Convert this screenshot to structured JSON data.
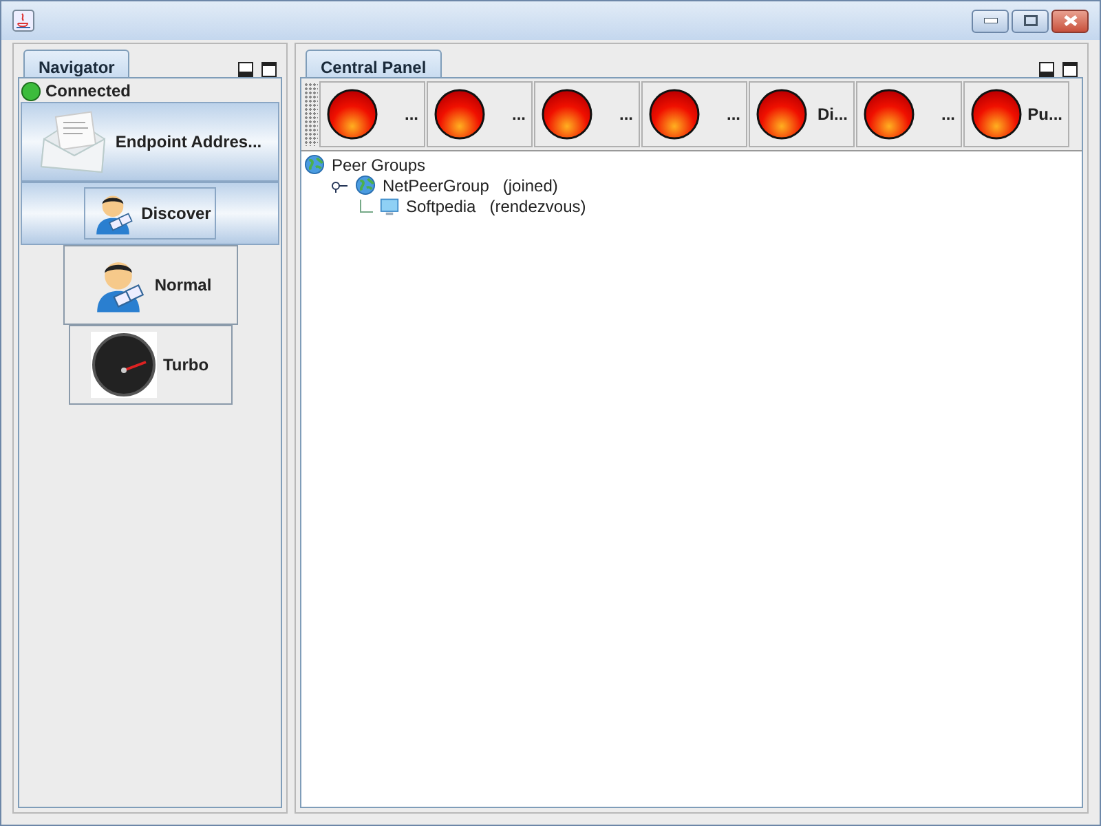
{
  "navigator": {
    "tab": "Navigator",
    "status": "Connected",
    "buttons": [
      {
        "kind": "envelope",
        "label": "Endpoint Addres...",
        "selected": true
      },
      {
        "kind": "discover",
        "label": "Discover",
        "selected": true
      },
      {
        "kind": "person",
        "label": "Normal",
        "selected": false
      },
      {
        "kind": "gauge",
        "label": "Turbo",
        "selected": false
      }
    ]
  },
  "central": {
    "tab": "Central Panel",
    "toolbar": [
      "...",
      "...",
      "...",
      "...",
      "Di...",
      "...",
      "Pu..."
    ],
    "tree": [
      {
        "name": "Peer Groups",
        "children": [
          {
            "name": "NetPeerGroup",
            "status": "(joined)",
            "children": [
              {
                "name": "Softpedia",
                "status": "(rendezvous)"
              }
            ]
          }
        ]
      }
    ]
  }
}
